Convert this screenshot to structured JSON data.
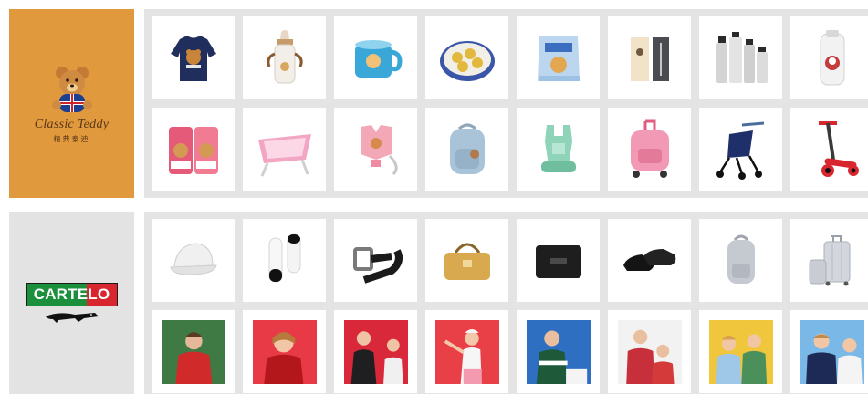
{
  "brands": {
    "teddy": {
      "name": "Classic Teddy",
      "subtitle_cn": "精典泰迪",
      "bg_color": "#e09a3d",
      "text_color": "#5a3517"
    },
    "cartelo": {
      "name": "CARTELO",
      "colors": {
        "green": "#1b8f3c",
        "red": "#d8262e"
      }
    }
  },
  "products_teddy": [
    {
      "icon": "sweater-icon"
    },
    {
      "icon": "baby-bottle-icon"
    },
    {
      "icon": "kids-cup-icon"
    },
    {
      "icon": "cookie-tin-icon"
    },
    {
      "icon": "snack-bag-icon"
    },
    {
      "icon": "pen-box-icon"
    },
    {
      "icon": "skincare-set-icon"
    },
    {
      "icon": "lotion-bottle-icon"
    },
    {
      "icon": "diaper-pack-icon"
    },
    {
      "icon": "baby-bathtub-icon"
    },
    {
      "icon": "safety-harness-icon"
    },
    {
      "icon": "kids-backpack-icon"
    },
    {
      "icon": "baby-carrier-icon"
    },
    {
      "icon": "trolley-backpack-icon"
    },
    {
      "icon": "stroller-icon"
    },
    {
      "icon": "kick-scooter-icon"
    }
  ],
  "products_cartelo": [
    {
      "icon": "cap-icon"
    },
    {
      "icon": "sneaker-icon"
    },
    {
      "icon": "belt-icon"
    },
    {
      "icon": "handbag-icon"
    },
    {
      "icon": "wallet-icon"
    },
    {
      "icon": "leather-shoes-icon"
    },
    {
      "icon": "backpack-icon"
    },
    {
      "icon": "luggage-icon"
    }
  ],
  "photos_cartelo": [
    {
      "icon": "model-photo-icon",
      "bg": "#3f7a45",
      "shirt": "#d12a2a"
    },
    {
      "icon": "model-photo-icon",
      "bg": "#e83a46",
      "shirt": "#b3171c"
    },
    {
      "icon": "model-photo-icon",
      "bg": "#d8283a",
      "shirt": "#1f1f22"
    },
    {
      "icon": "model-photo-icon",
      "bg": "#e94048",
      "shirt": "#f6f6f6"
    },
    {
      "icon": "model-photo-icon",
      "bg": "#2f6fc2",
      "shirt": "#1e5a3a"
    },
    {
      "icon": "model-photo-icon",
      "bg": "#f2f2f2",
      "shirt": "#c7303a"
    },
    {
      "icon": "model-photo-icon",
      "bg": "#f0c63c",
      "shirt": "#4b8f5a"
    },
    {
      "icon": "model-photo-icon",
      "bg": "#7ab8e8",
      "shirt": "#1d2a55"
    }
  ]
}
